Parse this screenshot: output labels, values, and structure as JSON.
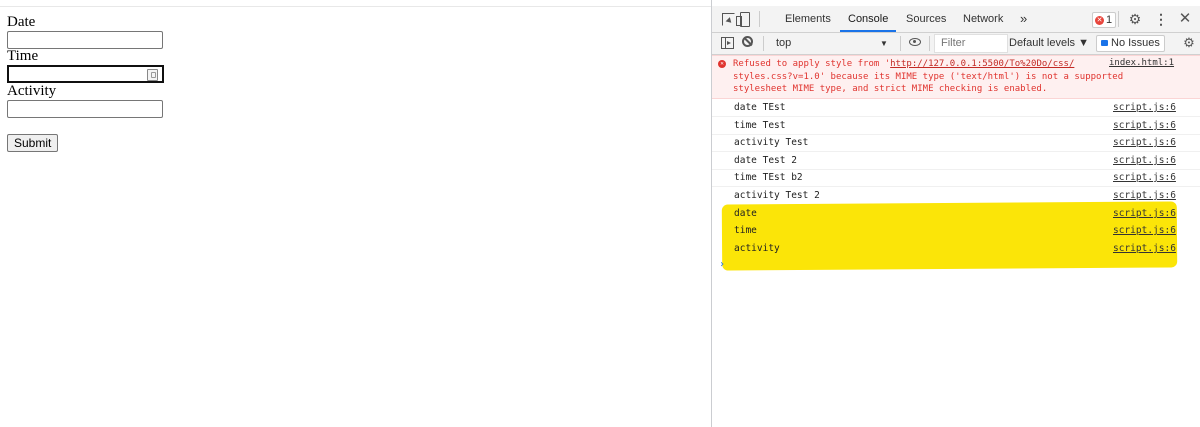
{
  "form": {
    "date_label": "Date",
    "time_label": "Time",
    "activity_label": "Activity",
    "submit_label": "Submit"
  },
  "devtools": {
    "tabs": [
      "Elements",
      "Console",
      "Sources",
      "Network"
    ],
    "more_tabs": "»",
    "error_count": "1",
    "toolbar": {
      "context": "top",
      "filter_placeholder": "Filter",
      "levels": "Default levels ▼",
      "issues": "No Issues"
    },
    "error": {
      "text": "Refused to apply style from 'http://127.0.0.1:5500/To%20Do/css/\nstyles.css?v=1.0' because its MIME type ('text/html') is not a supported\nstylesheet MIME type, and strict MIME checking is enabled.",
      "url_part": "http://127.0.0.1:5500/To%20Do/css/",
      "source": "index.html:1"
    },
    "logs": [
      {
        "msg": "date TEst",
        "src": "script.js:6"
      },
      {
        "msg": "time Test",
        "src": "script.js:6"
      },
      {
        "msg": "activity Test",
        "src": "script.js:6"
      },
      {
        "msg": "date Test 2",
        "src": "script.js:6"
      },
      {
        "msg": "time TEst b2",
        "src": "script.js:6"
      },
      {
        "msg": "activity Test 2",
        "src": "script.js:6"
      },
      {
        "msg": "date",
        "src": "script.js:6"
      },
      {
        "msg": "time",
        "src": "script.js:6"
      },
      {
        "msg": "activity",
        "src": "script.js:6"
      }
    ],
    "prompt": "›"
  },
  "colors": {
    "highlight": "#fbe508",
    "error_red": "#e0342f",
    "tab_active": "#1a73e8"
  }
}
